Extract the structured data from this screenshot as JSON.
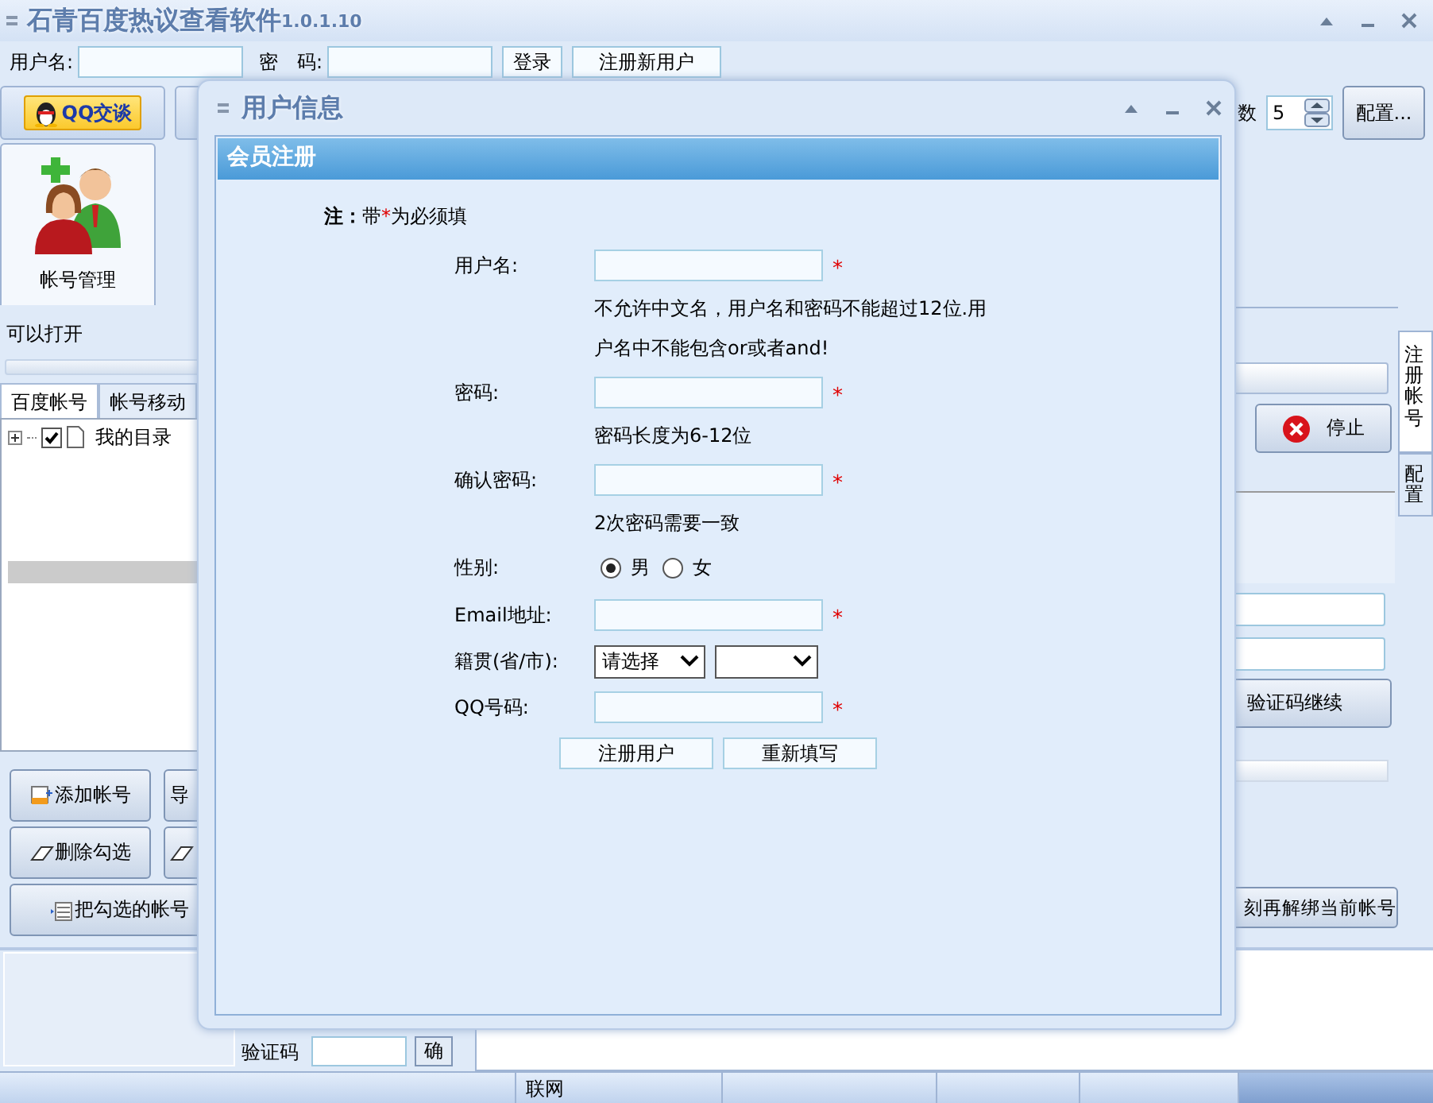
{
  "window": {
    "title": "石青百度热议查看软件",
    "version": "1.0.1.10"
  },
  "login": {
    "user_label": "用户名:",
    "password_label": "密　码:",
    "buttons": [
      "登录",
      "注册新用户"
    ]
  },
  "toolbar": {
    "qq_button": "QQ交谈",
    "count_label": "数",
    "count_value": "5",
    "config_button": "配置..."
  },
  "main_tabs": [
    {
      "label": "帐号管理",
      "selected": true
    }
  ],
  "left_panel": {
    "status": "可以打开",
    "tabs": [
      {
        "label": "百度帐号",
        "selected": true
      },
      {
        "label": "帐号移动",
        "selected": false
      }
    ],
    "tree": [
      {
        "label": "我的目录",
        "checked": true,
        "expanded": false
      }
    ],
    "buttons": [
      {
        "label": "添加帐号",
        "kind": "add"
      },
      {
        "label": "导",
        "kind": "plain"
      },
      {
        "label": "删除勾选",
        "kind": "eraser"
      },
      {
        "kind": "eraser"
      },
      {
        "label": "把勾选的帐号",
        "kind": "list"
      }
    ]
  },
  "right_panel": {
    "stop_button": "停止",
    "continue_button": "验证码继续",
    "unbind_button": "刻再解绑当前帐号"
  },
  "side_tabs": [
    {
      "label": "注册帐号",
      "selected": true
    },
    {
      "label": "配置",
      "selected": false
    }
  ],
  "captcha": {
    "label": "验证码",
    "button": "确"
  },
  "status_bar": {
    "connection": "联网"
  },
  "dialog": {
    "title": "用户信息",
    "header": "会员注册",
    "note": {
      "lead": "**注：**带",
      "mark": "*",
      "rest": "为必须填"
    },
    "fields": [
      {
        "kind": "text",
        "label": "用户名:",
        "required": true,
        "hint": [
          "不允许中文名，用户名和密码不能超过12位.用",
          "户名中不能包含or或者and!"
        ]
      },
      {
        "kind": "text",
        "label": "密码:",
        "required": true,
        "hint": [
          "密码长度为6-12位"
        ]
      },
      {
        "kind": "text",
        "label": "确认密码:",
        "required": true,
        "hint": [
          "2次密码需要一致"
        ]
      },
      {
        "kind": "radio",
        "label": "性别:",
        "options": [
          {
            "label": "男",
            "selected": true
          },
          {
            "label": "女",
            "selected": false
          }
        ]
      },
      {
        "kind": "text",
        "label": "Email地址:",
        "required": true
      },
      {
        "kind": "select",
        "label": "籍贯(省/市):",
        "selects": [
          {
            "kind": "province",
            "value": "请选择"
          },
          {
            "kind": "city"
          }
        ]
      },
      {
        "kind": "text",
        "label": "QQ号码:",
        "required": true
      }
    ],
    "buttons": [
      "注册用户",
      "重新填写"
    ]
  }
}
